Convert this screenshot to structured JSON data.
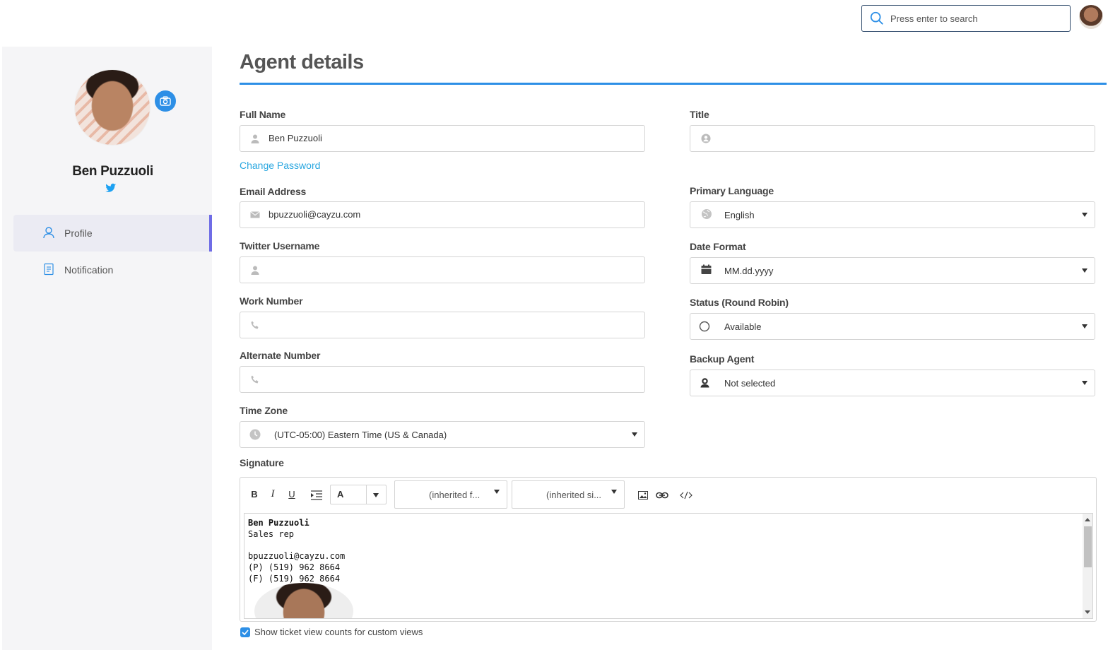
{
  "header": {
    "search_placeholder": "Press enter to search"
  },
  "sidebar": {
    "name": "Ben Puzzuoli",
    "items": [
      {
        "label": "Profile",
        "active": true
      },
      {
        "label": "Notification",
        "active": false
      }
    ]
  },
  "page": {
    "title": "Agent details"
  },
  "form": {
    "full_name_label": "Full Name",
    "full_name_value": "Ben Puzzuoli",
    "change_password": "Change Password",
    "email_label": "Email Address",
    "email_value": "bpuzzuoli@cayzu.com",
    "twitter_label": "Twitter Username",
    "twitter_value": "",
    "work_number_label": "Work Number",
    "work_number_value": "",
    "alternate_number_label": "Alternate Number",
    "alternate_number_value": "",
    "timezone_label": "Time Zone",
    "timezone_value": "(UTC-05:00) Eastern Time (US & Canada)",
    "title_label": "Title",
    "title_value": "",
    "language_label": "Primary Language",
    "language_value": "English",
    "date_format_label": "Date Format",
    "date_format_value": "MM.dd.yyyy",
    "status_label": "Status (Round Robin)",
    "status_value": "Available",
    "backup_agent_label": "Backup Agent",
    "backup_agent_value": "Not selected",
    "signature_label": "Signature"
  },
  "editor": {
    "toolbar": {
      "bold": "B",
      "italic": "I",
      "underline": "U",
      "font_color": "A",
      "font_family": "(inherited f...",
      "font_size": "(inherited si..."
    },
    "content": {
      "line1": "Ben Puzzuoli",
      "line2": "Sales rep",
      "line3": "bpuzzuoli@cayzu.com",
      "line4": "(P) (519) 962 8664",
      "line5": "(F) (519) 962 8664"
    }
  },
  "options": {
    "ticket_counts_label": "Show ticket view counts for custom views",
    "ticket_counts_checked": true
  },
  "colors": {
    "accent": "#2d8fe6",
    "nav_active_border": "#6f6ce6",
    "link": "#2aa7e0"
  }
}
